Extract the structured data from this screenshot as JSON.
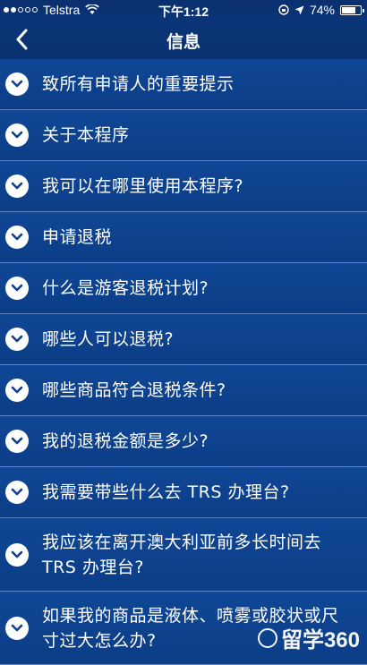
{
  "status_bar": {
    "carrier": "Telstra",
    "time": "下午1:12",
    "battery": "74%",
    "battery_level": 0.74
  },
  "nav": {
    "title": "信息"
  },
  "items": [
    {
      "label": "致所有申请人的重要提示"
    },
    {
      "label": "关于本程序"
    },
    {
      "label": "我可以在哪里使用本程序?"
    },
    {
      "label": "申请退税"
    },
    {
      "label": "什么是游客退税计划?"
    },
    {
      "label": "哪些人可以退税?"
    },
    {
      "label": "哪些商品符合退税条件?"
    },
    {
      "label": "我的退税金额是多少?"
    },
    {
      "label": "我需要带些什么去 TRS 办理台?"
    },
    {
      "label": "我应该在离开澳大利亚前多长时间去 TRS 办理台?"
    },
    {
      "label": "如果我的商品是液体、喷雾或胶状或尺寸过大怎么办?"
    }
  ],
  "watermark": {
    "text": "留学360"
  }
}
